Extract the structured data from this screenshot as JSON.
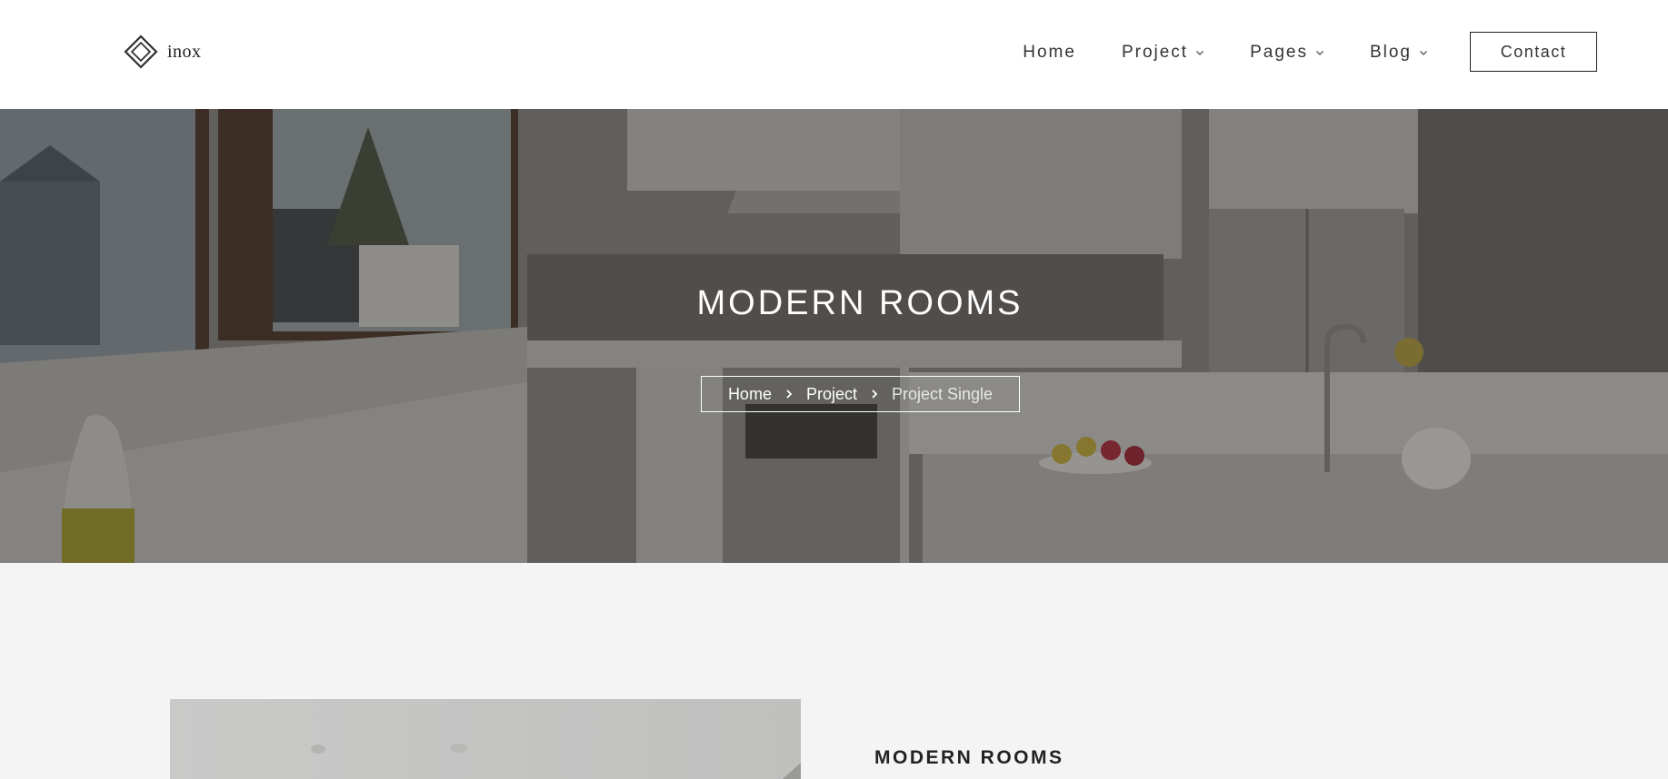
{
  "brand": {
    "name": "inox"
  },
  "nav": {
    "items": [
      {
        "label": "Home",
        "has_dropdown": false
      },
      {
        "label": "Project",
        "has_dropdown": true
      },
      {
        "label": "Pages",
        "has_dropdown": true
      },
      {
        "label": "Blog",
        "has_dropdown": true
      }
    ],
    "contact_label": "Contact"
  },
  "hero": {
    "title": "MODERN ROOMS",
    "breadcrumb": {
      "home": "Home",
      "project": "Project",
      "current": "Project Single"
    }
  },
  "content": {
    "section_title": "MODERN ROOMS"
  },
  "icons": {
    "logo": "diamond-logo-icon",
    "dropdown": "chevron-down-icon",
    "separator": "chevron-right-icon"
  },
  "colors": {
    "header_bg": "#ffffff",
    "text_dark": "#222222",
    "page_bg": "#f4f4f4"
  }
}
